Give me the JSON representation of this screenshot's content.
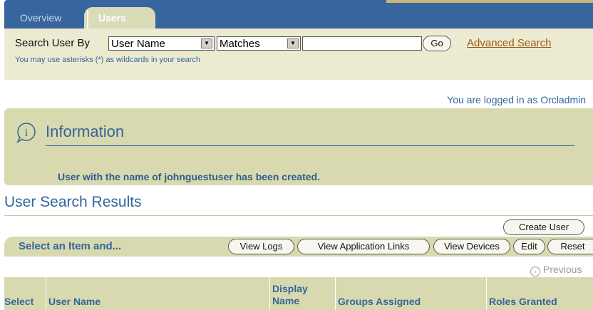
{
  "tabs": [
    {
      "label": "Overview",
      "active": false
    },
    {
      "label": "Users",
      "active": true
    }
  ],
  "search": {
    "label": "Search User By",
    "field_value": "User Name",
    "operator_value": "Matches",
    "text_value": "",
    "go_label": "Go",
    "advanced_label": "Advanced Search",
    "hint": "You may use asterisks (*) as wildcards in your search"
  },
  "session": {
    "logged_in_text": "You are logged in as Orcladmin"
  },
  "info": {
    "title": "Information",
    "message": "User with the name of johnguestuser has been created."
  },
  "results": {
    "title": "User Search Results",
    "create_label": "Create User",
    "select_label": "Select an Item and...",
    "actions": [
      "View Logs",
      "View Application Links",
      "View Devices",
      "Edit",
      "Reset"
    ],
    "previous_label": "Previous",
    "columns": [
      "Select",
      "User Name",
      "Display Name",
      "Groups Assigned",
      "Roles Granted"
    ]
  },
  "colors": {
    "tab_blue": "#39659e",
    "panel_tan": "#d9d9b0",
    "link_brown": "#9c5a13",
    "text_blue": "#336699"
  },
  "icons": {
    "info": "info-icon",
    "previous": "previous-icon",
    "dropdown": "chevron-down-icon"
  }
}
